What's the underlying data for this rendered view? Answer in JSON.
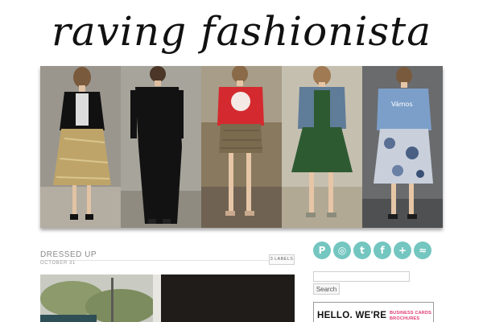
{
  "blog": {
    "title": "raving fashionista"
  },
  "banner": {
    "panels": [
      {
        "name": "banner-photo-sequin-skirt",
        "bg": "#9a968e",
        "top": "#111111",
        "bottom": "#bfa469"
      },
      {
        "name": "banner-photo-black-dress",
        "bg": "#a7a49b",
        "top": "#121212",
        "bottom": "#101010"
      },
      {
        "name": "banner-photo-red-tee",
        "bg": "#88795f",
        "top": "#d42a2f",
        "bottom": "#7a6a4e"
      },
      {
        "name": "banner-photo-green-skirt",
        "bg": "#c5bfb0",
        "top": "#5f7c98",
        "bottom": "#2e5a32"
      },
      {
        "name": "banner-photo-floral-skirt",
        "bg": "#6a6b6d",
        "top": "#7c9fc9",
        "bottom": "#c9d0dc"
      }
    ]
  },
  "post": {
    "title": "DRESSED UP",
    "date": "OCTOBER 31",
    "labels_button": "3 LABELS"
  },
  "social": [
    {
      "icon": "pinterest-icon",
      "glyph": "P"
    },
    {
      "icon": "instagram-icon",
      "glyph": "◎"
    },
    {
      "icon": "twitter-icon",
      "glyph": "t"
    },
    {
      "icon": "facebook-icon",
      "glyph": "f"
    },
    {
      "icon": "bloglovin-icon",
      "glyph": "+"
    },
    {
      "icon": "rss-icon",
      "glyph": "≈"
    }
  ],
  "sidebar": {
    "search_placeholder": "",
    "search_button": "Search",
    "ad": {
      "headline": "HELLO. WE'RE",
      "side_line1": "BUSINESS CARDS",
      "side_line2": "BROCHURES"
    }
  },
  "colors": {
    "social_teal": "#74c6c0",
    "ad_pink": "#e03a73",
    "text_gray": "#8a8a8a"
  }
}
